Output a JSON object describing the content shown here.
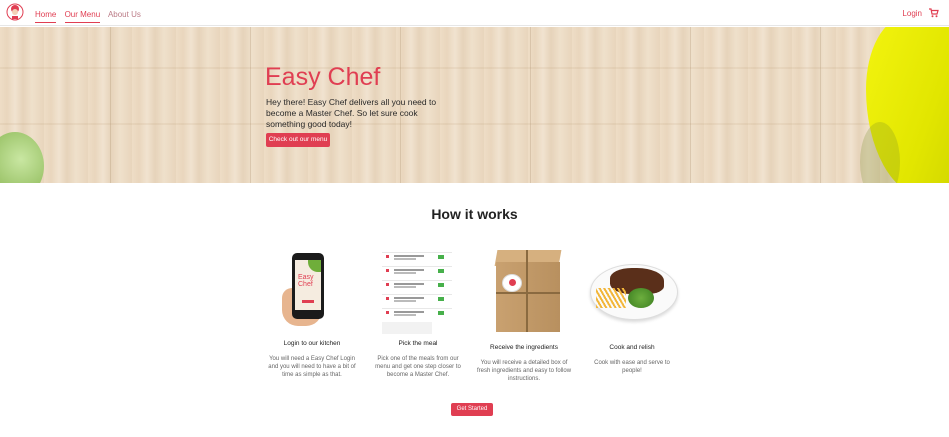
{
  "nav": {
    "links": [
      {
        "label": "Home"
      },
      {
        "label": "Our Menu"
      },
      {
        "label": "About Us"
      }
    ],
    "login_label": "Login"
  },
  "hero": {
    "title": "Easy Chef",
    "text": "Hey there! Easy Chef delivers all you need to become a Master Chef. So let sure cook something good today!",
    "button_label": "Check out our menu"
  },
  "how": {
    "title": "How it works",
    "steps": [
      {
        "title": "Login to our kitchen",
        "desc": "You will need a Easy Chef Login and you will need to have a bit of time as simple as that."
      },
      {
        "title": "Pick the meal",
        "desc": "Pick one of the meals from our menu and get one step closer to become a Master Chef."
      },
      {
        "title": "Receive the ingredients",
        "desc": "You will receive a detailed box of fresh ingredients and easy to follow instructions."
      },
      {
        "title": "Cook and relish",
        "desc": "Cook with ease and serve to people!"
      }
    ],
    "phone_screen_text": "Easy Chef",
    "cta_label": "Get Started"
  },
  "colors": {
    "accent": "#e03e52"
  },
  "icons": {
    "logo": "chef-logo-icon",
    "cart": "cart-icon"
  }
}
